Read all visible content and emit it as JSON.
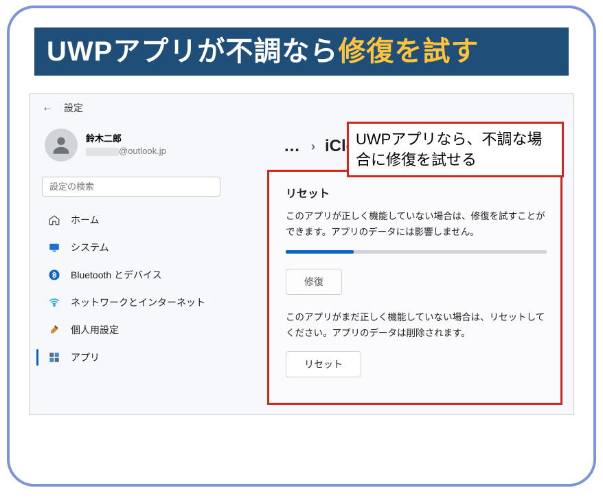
{
  "headline": {
    "part1": "UWPアプリが不調なら",
    "part2": "修復を試す"
  },
  "callout": "UWPアプリなら、不調な場合に修復を試せる",
  "window": {
    "title": "設定",
    "breadcrumb_app": "iCloud",
    "profile": {
      "name": "鈴木二郎",
      "email_suffix": "@outlook.jp"
    },
    "search_placeholder": "設定の検索",
    "nav": [
      {
        "key": "home",
        "label": "ホーム"
      },
      {
        "key": "system",
        "label": "システム"
      },
      {
        "key": "bluetooth",
        "label": "Bluetooth とデバイス"
      },
      {
        "key": "network",
        "label": "ネットワークとインターネット"
      },
      {
        "key": "personalization",
        "label": "個人用設定"
      },
      {
        "key": "apps",
        "label": "アプリ"
      }
    ],
    "reset": {
      "title": "リセット",
      "repair_desc": "このアプリが正しく機能していない場合は、修復を試すことができます。アプリのデータには影響しません。",
      "repair_button": "修復",
      "reset_desc": "このアプリがまだ正しく機能していない場合は、リセットしてください。アプリのデータは削除されます。",
      "reset_button": "リセット",
      "progress_pct": 26
    }
  }
}
